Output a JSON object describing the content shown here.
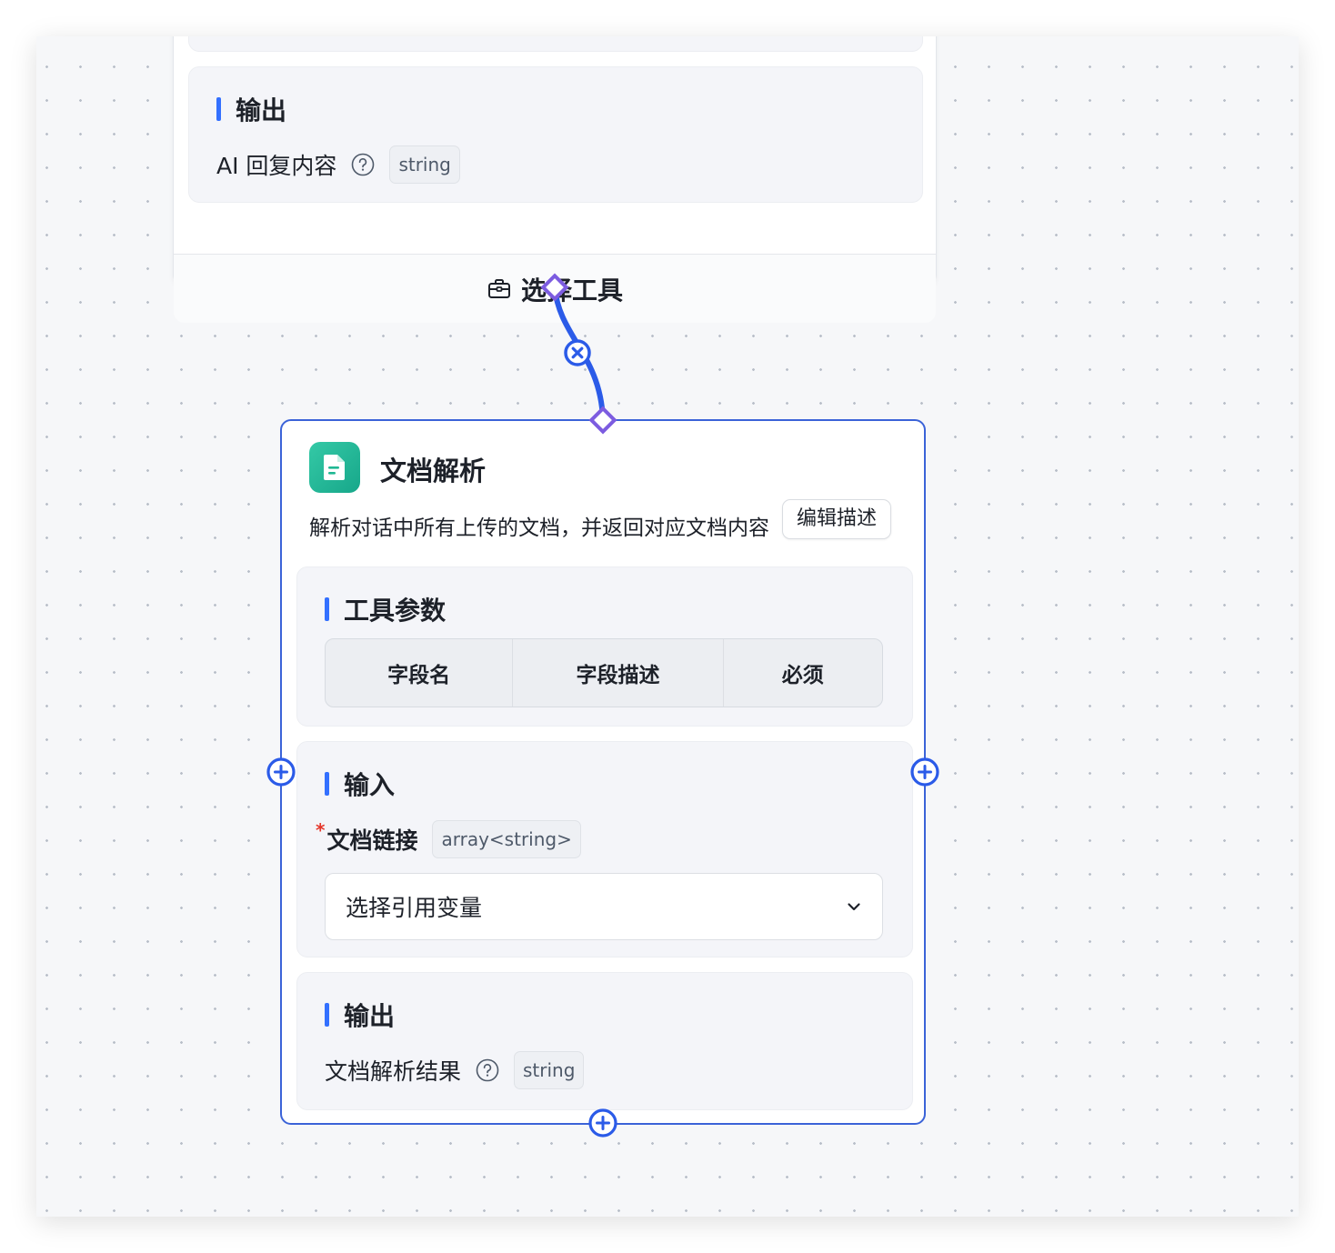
{
  "upper_node": {
    "output_section_title": "输出",
    "output_var_name": "AI 回复内容",
    "output_var_type": "string",
    "select_tool_label": "选择工具"
  },
  "tool_node": {
    "title": "文档解析",
    "description": "解析对话中所有上传的文档，并返回对应文档内容",
    "edit_description_button": "编辑描述",
    "params_section": {
      "title": "工具参数",
      "columns": [
        "字段名",
        "字段描述",
        "必须"
      ]
    },
    "input_section": {
      "title": "输入",
      "required_marker": "*",
      "field_label": "文档链接",
      "field_type": "array<string>",
      "select_placeholder": "选择引用变量"
    },
    "output_section": {
      "title": "输出",
      "var_name": "文档解析结果",
      "var_type": "string"
    }
  },
  "colors": {
    "accent": "#3370ff",
    "connector": "#2b5be8",
    "handle": "#7c5ce0",
    "node_icon": "#1fb893",
    "required": "#e5372b"
  },
  "icons": {
    "select_tool": "toolbox-icon",
    "help": "question-circle-icon",
    "node": "document-icon",
    "edge_delete": "close-circle-icon",
    "add_port": "plus-circle-icon",
    "dropdown": "chevron-down-icon"
  }
}
